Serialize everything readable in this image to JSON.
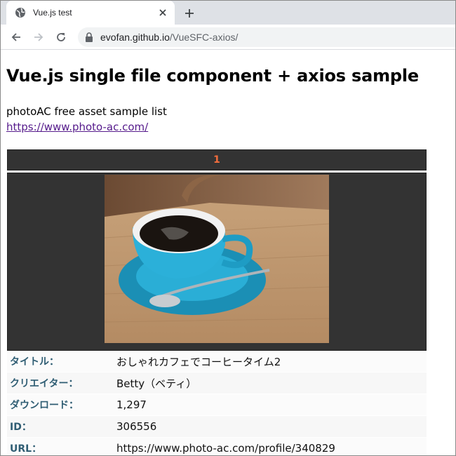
{
  "browser": {
    "tab_title": "Vue.js test",
    "url_host": "evofan.github.io",
    "url_path": "/VueSFC-axios/"
  },
  "page": {
    "heading": "Vue.js single file component + axios sample",
    "description": "photoAC free asset sample list",
    "link_text": "https://www.photo-ac.com/"
  },
  "card": {
    "number": "1",
    "rows": [
      {
        "label": "タイトル：",
        "value": "おしゃれカフェでコーヒータイム2"
      },
      {
        "label": "クリエイター：",
        "value": "Betty（ベティ）"
      },
      {
        "label": "ダウンロード：",
        "value": "1,297"
      },
      {
        "label": "ID：",
        "value": "306556"
      },
      {
        "label": "URL：",
        "value": "https://www.photo-ac.com/profile/340829"
      }
    ]
  },
  "colors": {
    "card_bg": "#333333",
    "number_color": "#f26d3d",
    "label_color": "#2f5d73",
    "link_color": "#551a8b"
  },
  "icons": {
    "tab_favicon": "globe-icon",
    "tab_close": "close-icon",
    "new_tab": "plus-icon",
    "back": "back-arrow-icon",
    "forward": "forward-arrow-icon",
    "reload": "reload-icon",
    "lock": "lock-icon"
  }
}
